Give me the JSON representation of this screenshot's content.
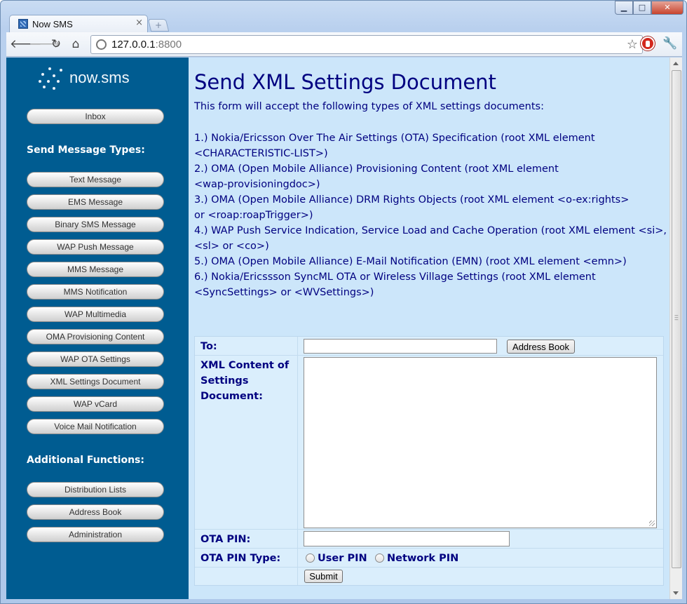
{
  "browser": {
    "tab_title": "Now SMS",
    "tab_close": "×",
    "new_tab": "+",
    "url_host": "127.0.0.1",
    "url_port": ":8800",
    "window_buttons": {
      "minimize": "▁",
      "maximize": "□",
      "close": "✕"
    }
  },
  "sidebar": {
    "logo_text": "now.sms",
    "inbox": "Inbox",
    "send_types_heading": "Send Message Types:",
    "send_types": [
      "Text Message",
      "EMS Message",
      "Binary SMS Message",
      "WAP Push Message",
      "MMS Message",
      "MMS Notification",
      "WAP Multimedia",
      "OMA Provisioning Content",
      "WAP OTA Settings",
      "XML Settings Document",
      "WAP vCard",
      "Voice Mail Notification"
    ],
    "additional_heading": "Additional Functions:",
    "additional": [
      "Distribution Lists",
      "Address Book",
      "Administration"
    ]
  },
  "main": {
    "title": "Send XML Settings Document",
    "intro": "This form will accept the following types of XML settings documents:",
    "doc_types": [
      "1.) Nokia/Ericsson Over The Air Settings (OTA) Specification (root XML element <CHARACTERISTIC-LIST>)",
      "2.) OMA (Open Mobile Alliance) Provisioning Content (root XML element <wap-provisioningdoc>)",
      "3.) OMA (Open Mobile Alliance) DRM Rights Objects (root XML element <o-ex:rights> or <roap:roapTrigger>)",
      "4.) WAP Push Service Indication, Service Load and Cache Operation (root XML element <si>, <sl> or <co>)",
      "5.) OMA (Open Mobile Alliance) E-Mail Notification (EMN) (root XML element <emn>)",
      "6.) Nokia/Ericssson SyncML OTA or Wireless Village Settings (root XML element <SyncSettings> or <WVSettings>)"
    ]
  },
  "form": {
    "to_label": "To:",
    "to_value": "",
    "address_book_button": "Address Book",
    "xml_label": "XML Content of Settings Document:",
    "xml_value": "",
    "pin_label": "OTA PIN:",
    "pin_value": "",
    "pin_type_label": "OTA PIN Type:",
    "pin_type_options": [
      "User PIN",
      "Network PIN"
    ],
    "submit_button": "Submit"
  }
}
